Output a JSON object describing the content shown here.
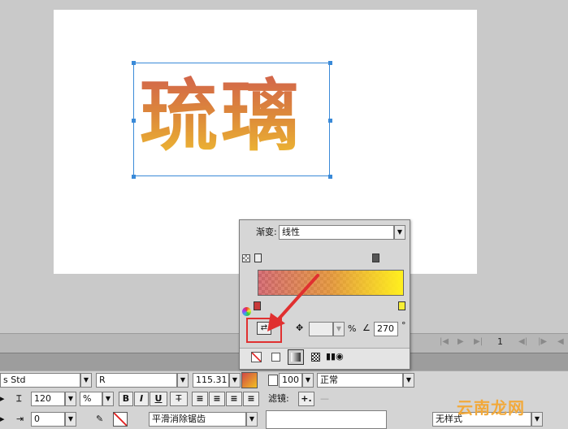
{
  "stage": {
    "text": "琉璃"
  },
  "timeline": {
    "frame": "1"
  },
  "gradient_panel": {
    "type_label": "渐变:",
    "type_value": "线性",
    "percent_symbol": "%",
    "angle_value": "270",
    "degree_symbol": "°"
  },
  "properties": {
    "font_name": "s Std",
    "font_style": "R",
    "font_size": "115.31",
    "line_spacing": "120",
    "indent": "0",
    "percent_unit": "%",
    "bold": "B",
    "italic": "I",
    "underline": "U",
    "opacity": "100",
    "blend_mode": "正常",
    "antialias": "平滑消除锯齿",
    "filter_label": "滤镜:",
    "filter_add": "+.",
    "filter_sep": "—",
    "style_value": "无样式"
  },
  "watermark": "云南龙网",
  "colors": {
    "accent_blue": "#3a8ad8",
    "highlight_red": "#e03030",
    "gradient_start": "#cc4650",
    "gradient_end": "#fff01e"
  }
}
